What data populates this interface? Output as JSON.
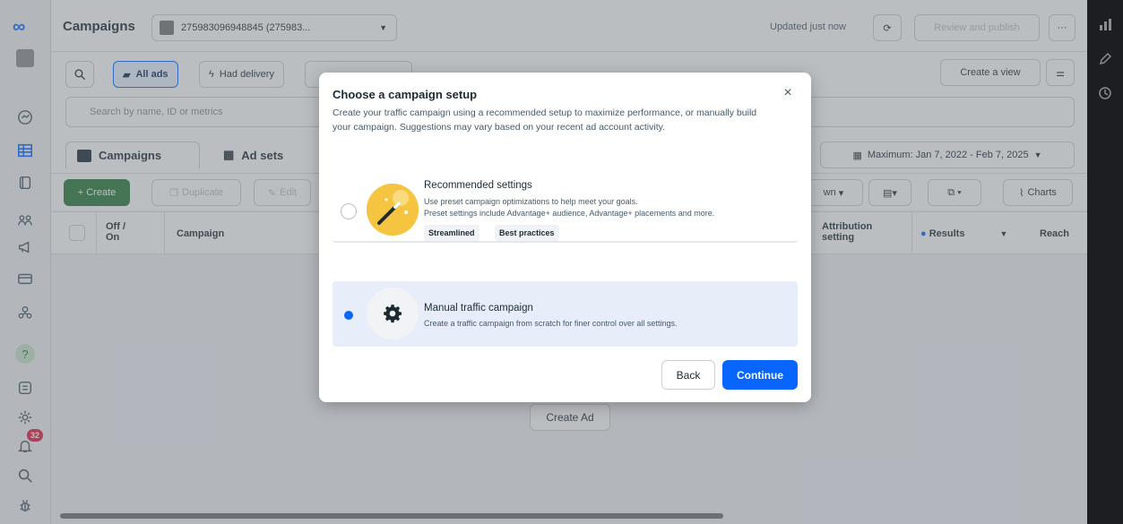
{
  "header": {
    "title": "Campaigns",
    "account_id": "275983096948845 (275983...",
    "updated_text": "Updated just now",
    "review_publish_label": "Review and publish",
    "more_label": "···"
  },
  "toolbar": {
    "all_ads_label": "All ads",
    "had_delivery_label": "Had delivery",
    "create_view_label": "Create a view",
    "search_placeholder": "Search by name, ID or metrics"
  },
  "tabs": {
    "campaigns_label": "Campaigns",
    "adsets_label": "Ad sets",
    "date_range": "Maximum: Jan 7, 2022 - Feb 7, 2025"
  },
  "actions": {
    "create_label": "+ Create",
    "duplicate_label": "Duplicate",
    "edit_label": "Edit",
    "breakdown_label": "wn",
    "charts_label": "Charts"
  },
  "table": {
    "col_off_on": "Off / On",
    "col_campaign": "Campaign",
    "col_attribution": "Attribution setting",
    "col_results": "Results",
    "col_reach": "Reach",
    "create_ad_label": "Create Ad"
  },
  "leftnav": {
    "notification_count": "32",
    "help_glyph": "?"
  },
  "modal": {
    "title": "Choose a campaign setup",
    "description": "Create your traffic campaign using a recommended setup to maximize performance, or manually build your campaign. Suggestions may vary based on your recent ad account activity.",
    "close_glyph": "×",
    "options": [
      {
        "title": "Recommended settings",
        "line1": "Use preset campaign optimizations to help meet your goals.",
        "line2": "Preset settings include Advantage+ audience, Advantage+ placements and more.",
        "tags": [
          "Streamlined",
          "Best practices"
        ],
        "selected": false
      },
      {
        "title": "Manual traffic campaign",
        "line1": "Create a traffic campaign from scratch for finer control over all settings.",
        "selected": true
      }
    ],
    "back_label": "Back",
    "continue_label": "Continue"
  },
  "colors": {
    "accent": "#0866ff",
    "create_green": "#2a7a3b",
    "selected_option_bg": "#e7eef9",
    "badge_red": "#e41e3f"
  }
}
